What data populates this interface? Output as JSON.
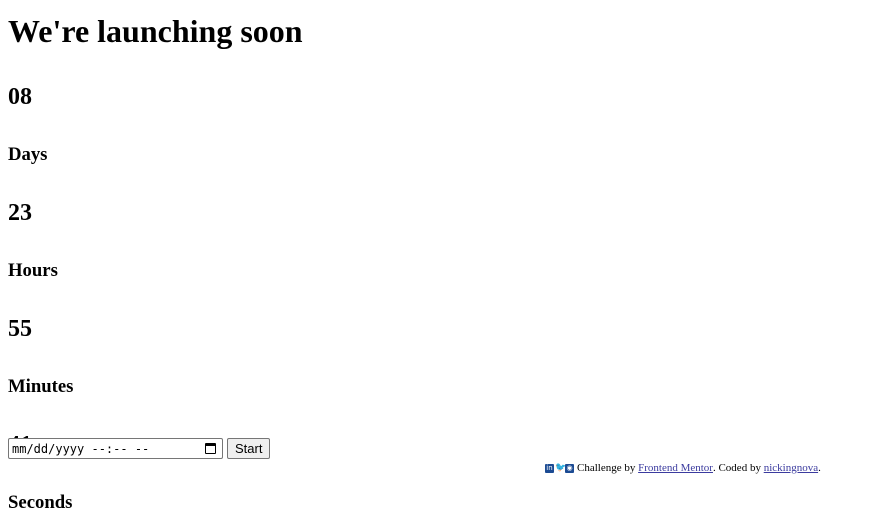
{
  "title": "We're launching soon",
  "countdown": [
    {
      "value": "08",
      "label": "Days"
    },
    {
      "value": "23",
      "label": "Hours"
    },
    {
      "value": "55",
      "label": "Minutes"
    },
    {
      "value": "41",
      "label": "Seconds"
    }
  ],
  "controls": {
    "datetime_placeholder": "mm/dd/yyyy --:-- --",
    "start_label": "Start"
  },
  "attribution": {
    "icons": [
      "linkedin-icon",
      "twitter-icon",
      "github-icon"
    ],
    "prefix": "Challenge by ",
    "link1": "Frontend Mentor",
    "middle": ". Coded by ",
    "link2": "nickingnova",
    "suffix": "."
  }
}
